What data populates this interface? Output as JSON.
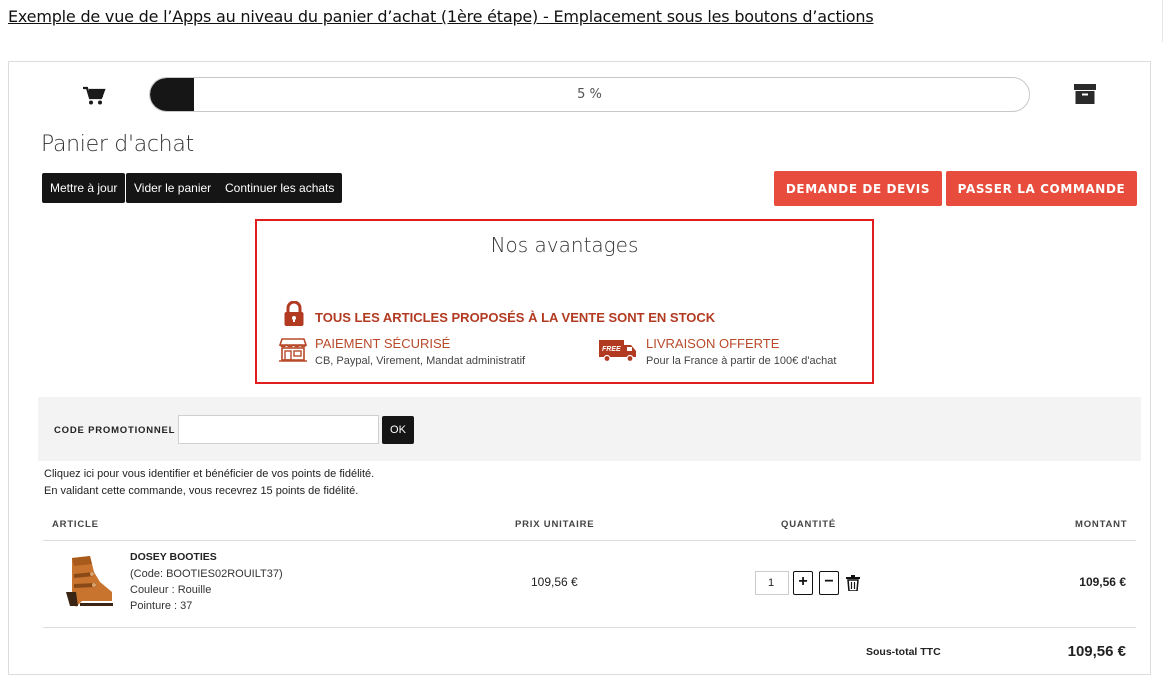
{
  "caption": "Exemple de vue de l’Apps au niveau du panier d’achat (1ère étape) - Emplacement sous les boutons d’actions",
  "progress": {
    "label": "5 %",
    "value_percent": 5
  },
  "page_title": "Panier d'achat",
  "actions": {
    "update": "Mettre à jour",
    "empty": "Vider le panier",
    "continue": "Continuer les achats",
    "quote": "DEMANDE DE DEVIS",
    "order": "PASSER LA COMMANDE"
  },
  "advantages": {
    "title": "Nos avantages",
    "stock": "TOUS LES ARTICLES PROPOSÉS À LA VENTE SONT EN STOCK",
    "payment_title": "PAIEMENT SÉCURISÉ",
    "payment_sub": "CB, Paypal, Virement, Mandat administratif",
    "delivery_badge": "FREE",
    "delivery_title": "LIVRAISON OFFERTE",
    "delivery_sub": "Pour la France à partir de 100€ d'achat"
  },
  "promo": {
    "label": "CODE PROMOTIONNEL :",
    "value": "",
    "ok": "OK"
  },
  "info": {
    "login": "Cliquez ici pour vous identifier et bénéficier de vos points de fidélité.",
    "points": "En validant cette commande, vous recevrez 15 points de fidélité."
  },
  "table": {
    "headers": {
      "article": "ARTICLE",
      "unit_price": "PRIX UNITAIRE",
      "quantity": "QUANTITÉ",
      "amount": "MONTANT"
    },
    "row": {
      "name": "DOSEY BOOTIES",
      "code": "(Code: BOOTIES02ROUILT37)",
      "color": "Couleur : Rouille",
      "size": "Pointure : 37",
      "unit_price": "109,56 €",
      "quantity": "1",
      "plus": "+",
      "minus": "−",
      "amount": "109,56 €"
    },
    "subtotal_label": "Sous-total TTC",
    "subtotal_value": "109,56 €"
  },
  "colors": {
    "accent_red": "#e74c3c",
    "highlight_border": "#e21d1d",
    "advantage_text": "#b13a21",
    "dark_button": "#151515"
  },
  "icons": [
    "cart-icon",
    "archive-box-icon",
    "lock-icon",
    "shop-icon",
    "free-delivery-truck-icon",
    "trash-icon"
  ]
}
